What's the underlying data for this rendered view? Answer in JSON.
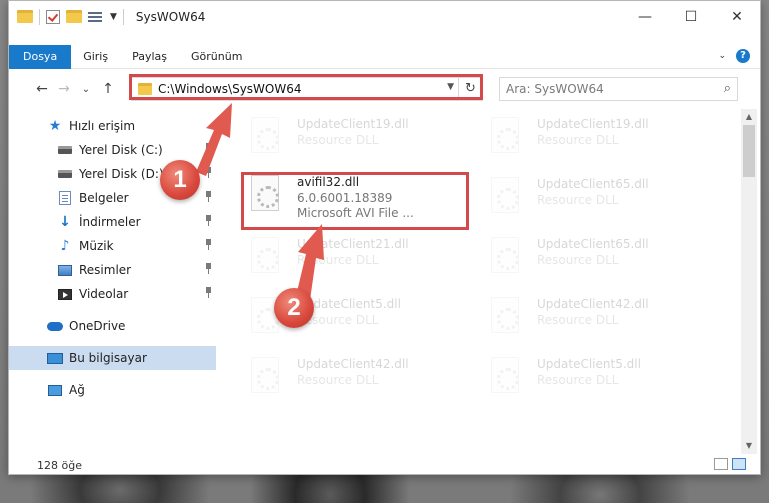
{
  "window": {
    "title": "SysWOW64"
  },
  "window_buttons": {
    "minimize": "—",
    "maximize": "☐",
    "close": "✕"
  },
  "ribbon": {
    "tabs": [
      {
        "label": "Dosya",
        "active": true
      },
      {
        "label": "Giriş"
      },
      {
        "label": "Paylaş"
      },
      {
        "label": "Görünüm"
      }
    ],
    "help": "?"
  },
  "nav": {
    "back": "←",
    "forward": "→",
    "recent": "⌄",
    "up": "↑",
    "address": "C:\\Windows\\SysWOW64",
    "search_placeholder": "Ara: SysWOW64"
  },
  "navpane": {
    "items": [
      {
        "label": "Hızlı erişim",
        "icon": "star-icon"
      },
      {
        "label": "Yerel Disk (C:)",
        "icon": "disk-icon",
        "pinned": true
      },
      {
        "label": "Yerel Disk (D:)",
        "icon": "disk-icon",
        "pinned": true
      },
      {
        "label": "Belgeler",
        "icon": "documents-icon",
        "pinned": true
      },
      {
        "label": "İndirmeler",
        "icon": "downloads-icon",
        "pinned": true
      },
      {
        "label": "Müzik",
        "icon": "music-icon",
        "pinned": true
      },
      {
        "label": "Resimler",
        "icon": "pictures-icon",
        "pinned": true
      },
      {
        "label": "Videolar",
        "icon": "videos-icon",
        "pinned": true
      },
      {
        "label": "OneDrive",
        "icon": "cloud-icon"
      },
      {
        "label": "Bu bilgisayar",
        "icon": "computer-icon",
        "selected": true
      },
      {
        "label": "Ağ",
        "icon": "network-icon"
      }
    ]
  },
  "files": {
    "highlighted": {
      "name": "avifil32.dll",
      "version": "6.0.6001.18389",
      "description": "Microsoft AVI File ..."
    },
    "faded_left": [
      {
        "name": "UpdateClient19.dll",
        "type": "Resource DLL"
      },
      {
        "name": "UpdateClient21.dll",
        "type": "Resource DLL"
      },
      {
        "name": "UpdateClient5.dll",
        "type": "Resource DLL"
      },
      {
        "name": "UpdateClient42.dll",
        "type": "Resource DLL"
      }
    ],
    "faded_right": [
      {
        "name": "UpdateClient19.dll",
        "type": "Resource DLL"
      },
      {
        "name": "UpdateClient65.dll",
        "type": "Resource DLL"
      },
      {
        "name": "UpdateClient65.dll",
        "type": "Resource DLL"
      },
      {
        "name": "UpdateClient42.dll",
        "type": "Resource DLL"
      },
      {
        "name": "UpdateClient5.dll",
        "type": "Resource DLL"
      }
    ]
  },
  "status": {
    "count": "128 öğe"
  },
  "annotations": {
    "step1": "1",
    "step2": "2",
    "color": "#d44a4a"
  }
}
